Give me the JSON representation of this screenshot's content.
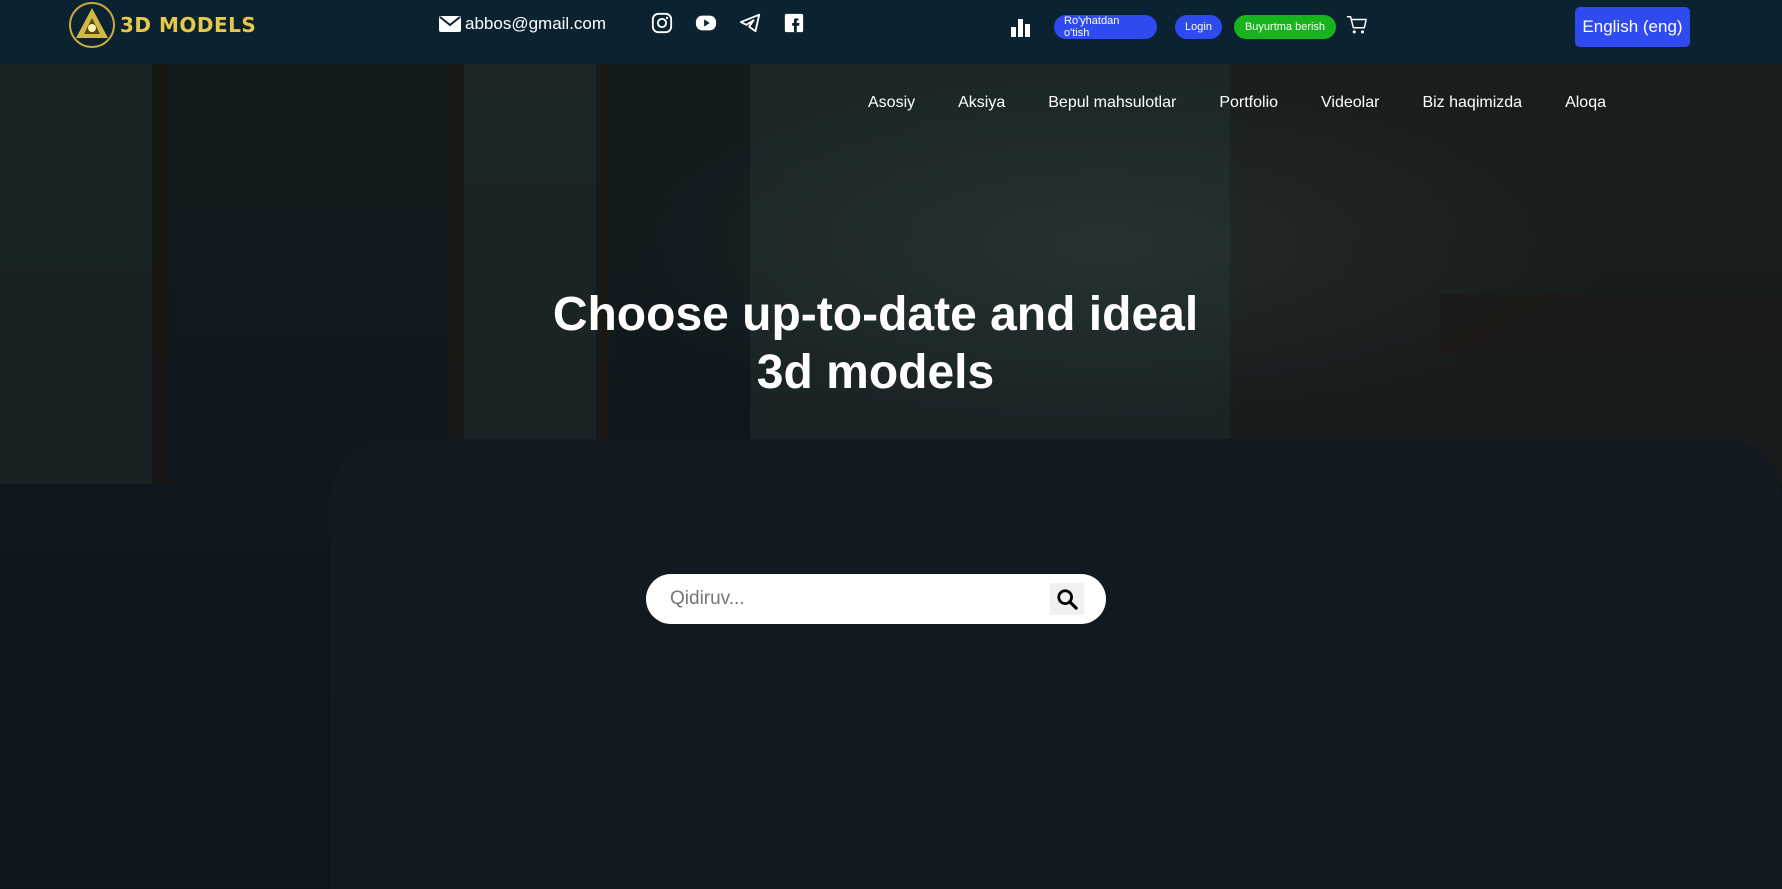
{
  "header": {
    "logo_text": "3D MODELS",
    "email": "abbos@gmail.com",
    "socials": [
      "instagram-icon",
      "youtube-icon",
      "telegram-icon",
      "facebook-icon"
    ],
    "register_label": "Ro'yhatdan o'tish",
    "login_label": "Login",
    "order_label": "Buyurtma berish",
    "language_label": "English (eng)"
  },
  "nav": {
    "items": [
      "Asosiy",
      "Aksiya",
      "Bepul mahsulotlar",
      "Portfolio",
      "Videolar",
      "Biz haqimizda",
      "Aloqa"
    ]
  },
  "hero": {
    "headline_line1": "Choose up-to-date and ideal",
    "headline_line2": "3d models"
  },
  "search": {
    "placeholder": "Qidiruv..."
  },
  "colors": {
    "topbar": "#0b2230",
    "accent_blue": "#2f4bf0",
    "accent_green": "#18b41e",
    "logo_gold": "#e6c84a"
  }
}
